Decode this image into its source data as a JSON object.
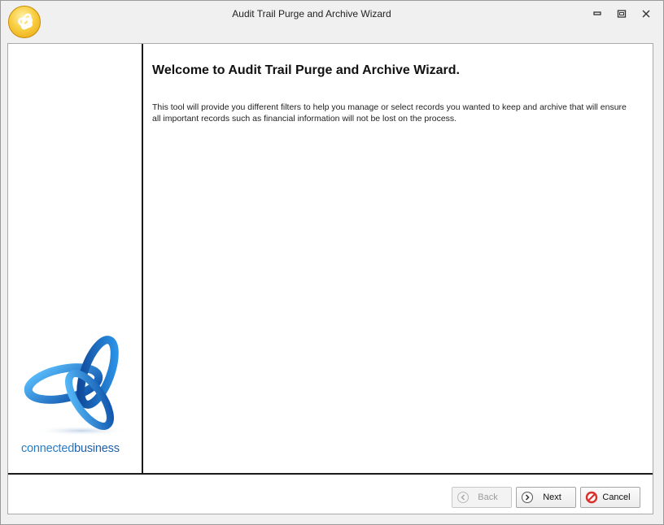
{
  "window": {
    "title": "Audit Trail Purge and Archive Wizard",
    "controls": {
      "minimize": "minimize",
      "maximize": "maximize",
      "close": "close"
    }
  },
  "sidebar": {
    "brand_part1": "connected",
    "brand_part2": "business",
    "logo_icon": "connected-business-logo"
  },
  "main": {
    "heading": "Welcome to Audit Trail Purge and Archive Wizard.",
    "description": "This tool will provide you different filters to help you manage or select records you wanted to keep and archive that will ensure all important records such as financial information will not be lost on the process."
  },
  "footer": {
    "back_label": "Back",
    "back_enabled": false,
    "next_label": "Next",
    "cancel_label": "Cancel"
  },
  "colors": {
    "brand_blue": "#2a7bc5",
    "orb_yellow": "#f8cf42",
    "cancel_red": "#d9302c"
  }
}
